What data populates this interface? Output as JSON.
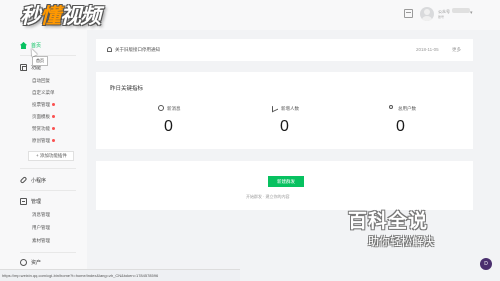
{
  "watermark": {
    "part1": "秒",
    "part2": "懂",
    "part3": "视频"
  },
  "header": {
    "account_name": "公众号",
    "account_sub": "账号"
  },
  "sidebar": {
    "home": "首页",
    "tooltip": "首页",
    "functions": "功能",
    "function_items": [
      "自动回复",
      "自定义菜单",
      "投票管理",
      "页面模板",
      "赞赏功能",
      "原创管理"
    ],
    "function_dots": [
      false,
      false,
      true,
      true,
      true,
      true
    ],
    "add_plugin": "+ 添加功能插件",
    "mini_program": "小程序",
    "manage": "管理",
    "manage_items": [
      "消息管理",
      "用户管理",
      "素材管理"
    ],
    "assets": "资产"
  },
  "notice": {
    "text": "关于旧版接口停用通知",
    "date": "2018-11-05",
    "more": "更多"
  },
  "stats": {
    "title": "昨日关键指标",
    "items": [
      {
        "label": "新消息",
        "value": "0"
      },
      {
        "label": "新增人数",
        "value": "0"
      },
      {
        "label": "总用户数",
        "value": "0"
      }
    ]
  },
  "publish": {
    "button": "新建群发",
    "hint": "开始群发 · 建立你的内容"
  },
  "status_bar": {
    "url": "https://mp.weixin.qq.com/cgi-bin/home?t=home/index&lang=zh_CN&token=1784578596"
  },
  "baidu": {
    "title": "百科全说",
    "subtitle": "助你轻松解决"
  },
  "float_button": "D"
}
